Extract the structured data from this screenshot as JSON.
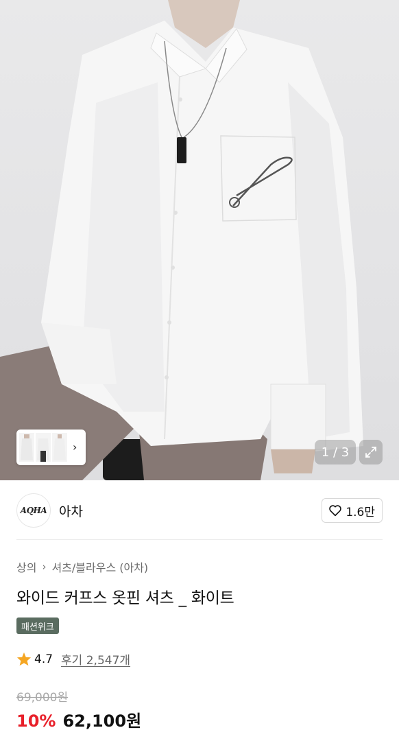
{
  "gallery": {
    "counter": "1 / 3",
    "next_icon": "chevron-right-icon",
    "expand_icon": "expand-icon",
    "background_color": "#e6e6e8"
  },
  "brand": {
    "logo_text": "AQHA",
    "name": "아차",
    "like_icon": "heart-outline-icon",
    "like_count": "1.6만"
  },
  "breadcrumb": {
    "category": "상의",
    "subcategory": "셔츠/블라우스 (아차)"
  },
  "product": {
    "title": "와이드 커프스 옷핀 셔츠 _ 화이트",
    "badge": "패션위크",
    "badge_color": "#5a6c60",
    "rating": "4.7",
    "reviews_label": "후기 2,547개",
    "original_price": "69,000원",
    "discount": "10%",
    "price": "62,100원",
    "discount_color": "#e8202a"
  }
}
